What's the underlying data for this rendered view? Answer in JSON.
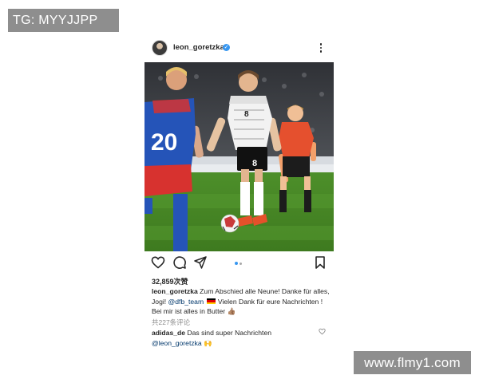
{
  "watermarks": {
    "top_left": "TG: MYYJJPP",
    "bottom_right": "www.flmy1.com"
  },
  "post": {
    "header": {
      "username": "leon_goretzka",
      "verified_icon": "verified-badge-icon",
      "more_icon": "more-options-icon"
    },
    "photo": {
      "player_number": "8",
      "opponent_number": "20"
    },
    "actions": {
      "icons": [
        "heart-icon",
        "comment-icon",
        "share-icon",
        "bookmark-icon"
      ],
      "carousel": {
        "count": 2,
        "active_index": 0
      }
    },
    "likes_text": "32,859次赞",
    "caption": {
      "username": "leon_goretzka",
      "text_before_mention": " Zum Abschied alle Neune! Danke für alles, Jogi! ",
      "mention": "@dfb_team",
      "text_after_mention": " Vielen Dank für eure Nachrichten ! Bei mir ist alles in Butter ",
      "emoji_flag": "german-flag-emoji",
      "emoji_end": "👍🏽"
    },
    "view_comments": "共227条评论",
    "top_comment": {
      "username": "adidas_de",
      "text": " Das sind super Nachrichten",
      "mention": "@leon_goretzka",
      "emoji": "🙌"
    }
  },
  "colors": {
    "accent_blue": "#3897f0",
    "text_primary": "#262626",
    "text_secondary": "#8e8e8e",
    "mention_blue": "#00376b",
    "watermark_gray": "#8e8e8e"
  }
}
